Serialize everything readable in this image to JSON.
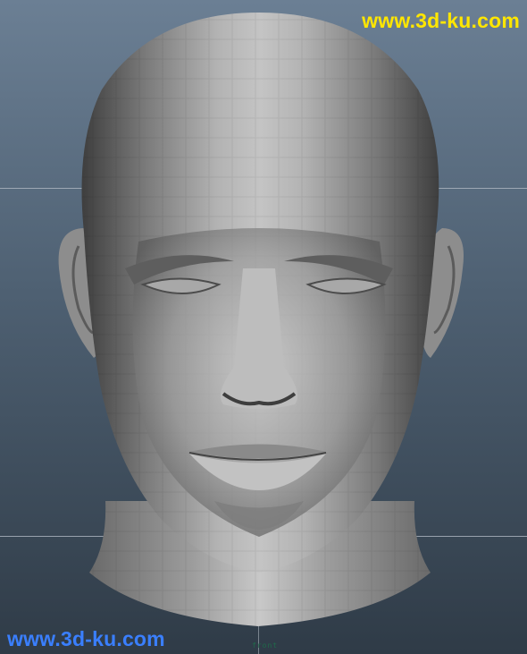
{
  "viewport": {
    "camera_label": "front"
  },
  "watermarks": {
    "top_right": "www.3d-ku.com",
    "bottom_left": "www.3d-ku.com"
  },
  "colors": {
    "watermark_top": "#ffe600",
    "watermark_bottom": "#3a7fff",
    "background_top": "#6b7f94",
    "background_bottom": "#2f3b47",
    "mesh_light": "#b9b9b9",
    "mesh_dark": "#4a4a4a"
  },
  "model": {
    "icon": "head-mesh-icon"
  }
}
